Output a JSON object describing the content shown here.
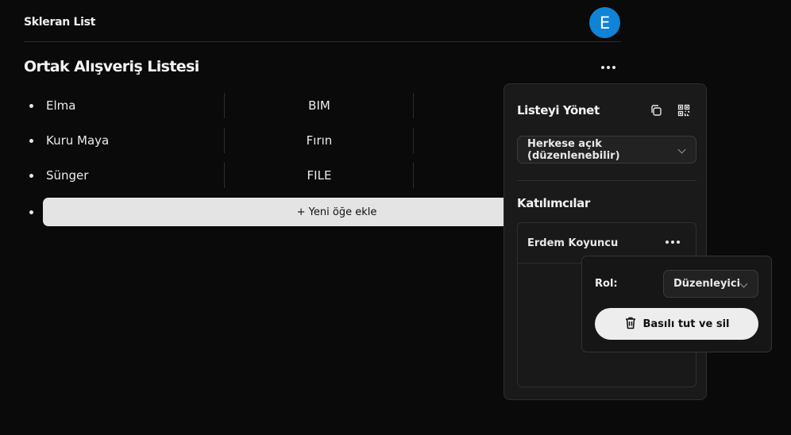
{
  "header": {
    "app_name": "Skleran List",
    "avatar_initial": "E"
  },
  "list": {
    "title": "Ortak Alışveriş Listesi",
    "items": [
      {
        "name": "Elma",
        "store": "BIM"
      },
      {
        "name": "Kuru Maya",
        "store": "Fırın"
      },
      {
        "name": "Sünger",
        "store": "FILE"
      }
    ],
    "add_item_label": "+ Yeni öğe ekle"
  },
  "manage_panel": {
    "title": "Listeyi Yönet",
    "copy_icon": "copy-icon",
    "qr_icon": "qr-code-icon",
    "visibility_value": "Herkese açık (düzenlenebilir)",
    "participants_title": "Katılımcılar",
    "participants": [
      {
        "name": "Erdem Koyuncu"
      }
    ]
  },
  "role_popover": {
    "role_label": "Rol:",
    "role_value": "Düzenleyici",
    "delete_label": "Basılı tut ve sil",
    "delete_icon": "trash-icon"
  },
  "colors": {
    "background": "#0a0a0a",
    "avatar": "#1183d6",
    "panel": "#1a1a1a",
    "button_light": "#e4e4e4"
  }
}
